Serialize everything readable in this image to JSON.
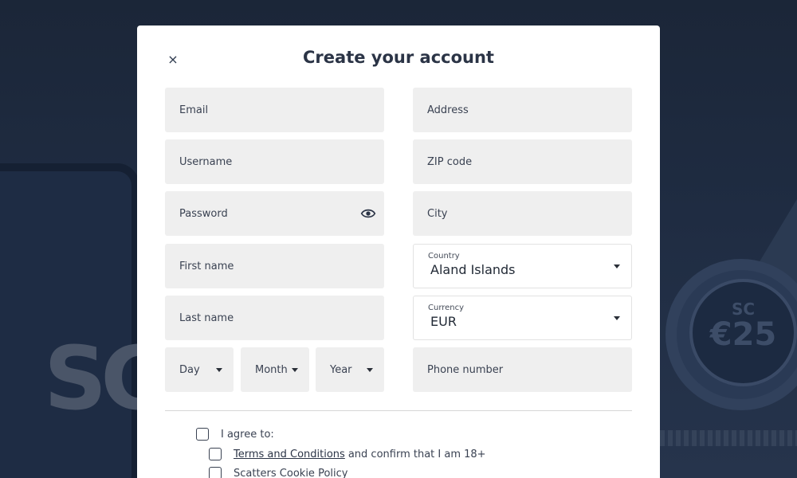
{
  "background": {
    "phone_logo": "SC",
    "chip_text": "SC",
    "chip_amount": "€25"
  },
  "modal": {
    "title": "Create your account",
    "close_symbol": "×"
  },
  "form": {
    "email_placeholder": "Email",
    "username_placeholder": "Username",
    "password_placeholder": "Password",
    "first_name_placeholder": "First name",
    "last_name_placeholder": "Last name",
    "day_label": "Day",
    "month_label": "Month",
    "year_label": "Year",
    "address_placeholder": "Address",
    "zip_placeholder": "ZIP code",
    "city_placeholder": "City",
    "country": {
      "label": "Country",
      "value": "Aland Islands"
    },
    "currency": {
      "label": "Currency",
      "value": "EUR"
    },
    "phone_placeholder": "Phone number"
  },
  "agreements": {
    "agree_label": "I agree to:",
    "terms_link": "Terms and Conditions",
    "terms_suffix": "and confirm that I am 18+",
    "cookie_label": "Scatters Cookie Policy"
  },
  "icons": {
    "close": "close-icon",
    "password_toggle": "eye-icon",
    "dropdown": "chevron-down-icon"
  }
}
